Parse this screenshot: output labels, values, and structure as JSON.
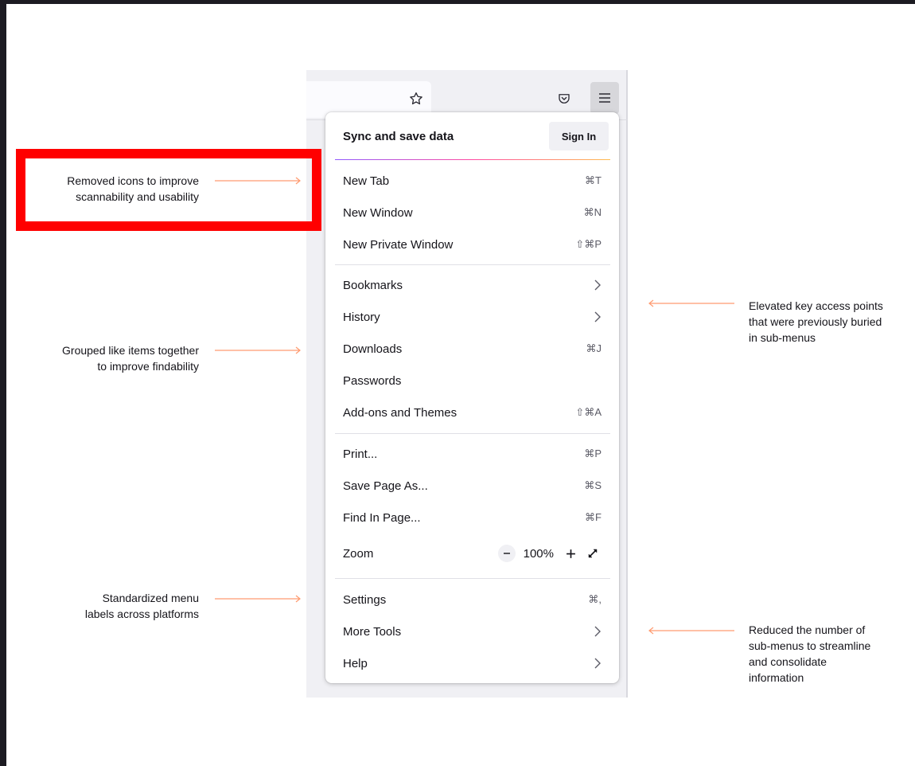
{
  "colors": {
    "accent_arrow": "#ff9b70",
    "highlight_box": "#ff0000",
    "menu_button_bg": "#d7d7db"
  },
  "toolbar": {
    "star_icon": "star-icon",
    "pocket_icon": "pocket-icon",
    "menu_icon": "hamburger-menu-icon"
  },
  "menu": {
    "sync_label": "Sync and save data",
    "sign_in_label": "Sign In",
    "group1": [
      {
        "label": "New Tab",
        "shortcut": "⌘T"
      },
      {
        "label": "New Window",
        "shortcut": "⌘N"
      },
      {
        "label": "New Private Window",
        "shortcut": "⇧⌘P"
      }
    ],
    "group2": [
      {
        "label": "Bookmarks",
        "shortcut": ""
      },
      {
        "label": "History",
        "shortcut": ""
      },
      {
        "label": "Downloads",
        "shortcut": "⌘J"
      },
      {
        "label": "Passwords",
        "shortcut": ""
      },
      {
        "label": "Add-ons and Themes",
        "shortcut": "⇧⌘A"
      }
    ],
    "group3": [
      {
        "label": "Print...",
        "shortcut": "⌘P"
      },
      {
        "label": "Save Page As...",
        "shortcut": "⌘S"
      },
      {
        "label": "Find In Page...",
        "shortcut": "⌘F"
      }
    ],
    "zoom": {
      "label": "Zoom",
      "value": "100%",
      "minus": "−",
      "plus": "+"
    },
    "group4": [
      {
        "label": "Settings",
        "shortcut": "⌘,"
      },
      {
        "label": "More Tools",
        "shortcut": ""
      },
      {
        "label": "Help",
        "shortcut": ""
      }
    ]
  },
  "annotations": {
    "left": [
      {
        "line1": "Removed icons to improve",
        "line2": "scannability and usability"
      },
      {
        "line1": "Grouped like items together",
        "line2": "to improve findability"
      },
      {
        "line1": "Standardized menu",
        "line2": "labels across platforms"
      }
    ],
    "right": [
      {
        "line1": "Elevated key access points",
        "line2": "that were previously buried",
        "line3": "in sub-menus"
      },
      {
        "line1": "Reduced the number of",
        "line2": "sub-menus to streamline",
        "line3": "and consolidate",
        "line4": "information"
      }
    ]
  }
}
